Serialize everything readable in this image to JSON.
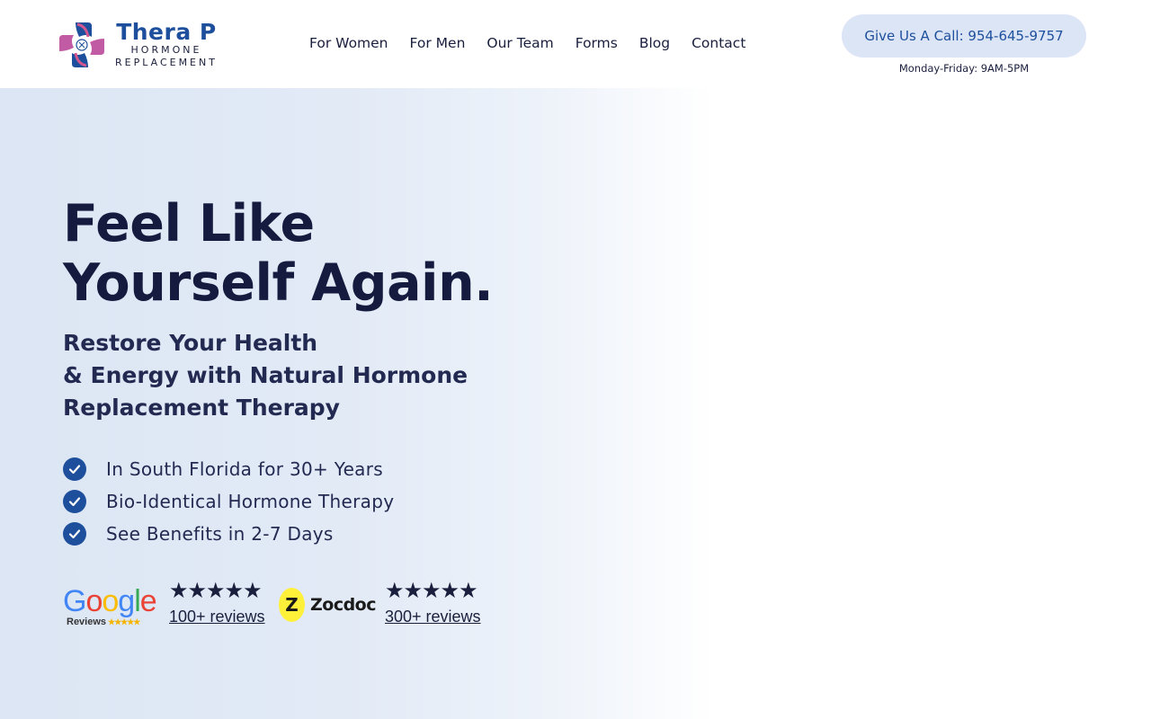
{
  "header": {
    "logo": {
      "title": "Thera P",
      "subtitle_line1": "HORMONE",
      "subtitle_line2": "REPLACEMENT"
    },
    "nav": [
      {
        "label": "For Women"
      },
      {
        "label": "For Men"
      },
      {
        "label": "Our Team"
      },
      {
        "label": "Forms"
      },
      {
        "label": "Blog"
      },
      {
        "label": "Contact"
      }
    ],
    "call_button": "Give Us A Call: 954-645-9757",
    "hours": "Monday-Friday: 9AM-5PM"
  },
  "hero": {
    "title_line1": "Feel Like",
    "title_line2": "Yourself Again.",
    "subtitle_line1": "Restore Your Health",
    "subtitle_line2": "& Energy with Natural Hormone",
    "subtitle_line3": "Replacement Therapy",
    "benefits": [
      {
        "text": "In South Florida for 30+ Years"
      },
      {
        "text": "Bio-Identical Hormone Therapy"
      },
      {
        "text": "See Benefits in 2-7 Days"
      }
    ]
  },
  "reviews": {
    "google": {
      "logo_word": "Google",
      "logo_caption": "Reviews",
      "rating_stars": 5,
      "stars": "★★★★★",
      "link": "100+ reviews"
    },
    "zocdoc": {
      "logo_mark": "Z",
      "logo_word": "Zocdoc",
      "rating_stars": 5,
      "stars": "★★★★★",
      "link": "300+ reviews"
    }
  },
  "colors": {
    "brand_blue": "#1e4f9c",
    "navy_text": "#141b3f",
    "call_button_bg": "#dbe5f6",
    "hero_gradient_start": "#dce6f4",
    "zocdoc_yellow": "#fff03a"
  },
  "icons": {
    "logo": "cross-logo-icon",
    "benefit": "check-circle-icon",
    "rating": "star-icon"
  }
}
